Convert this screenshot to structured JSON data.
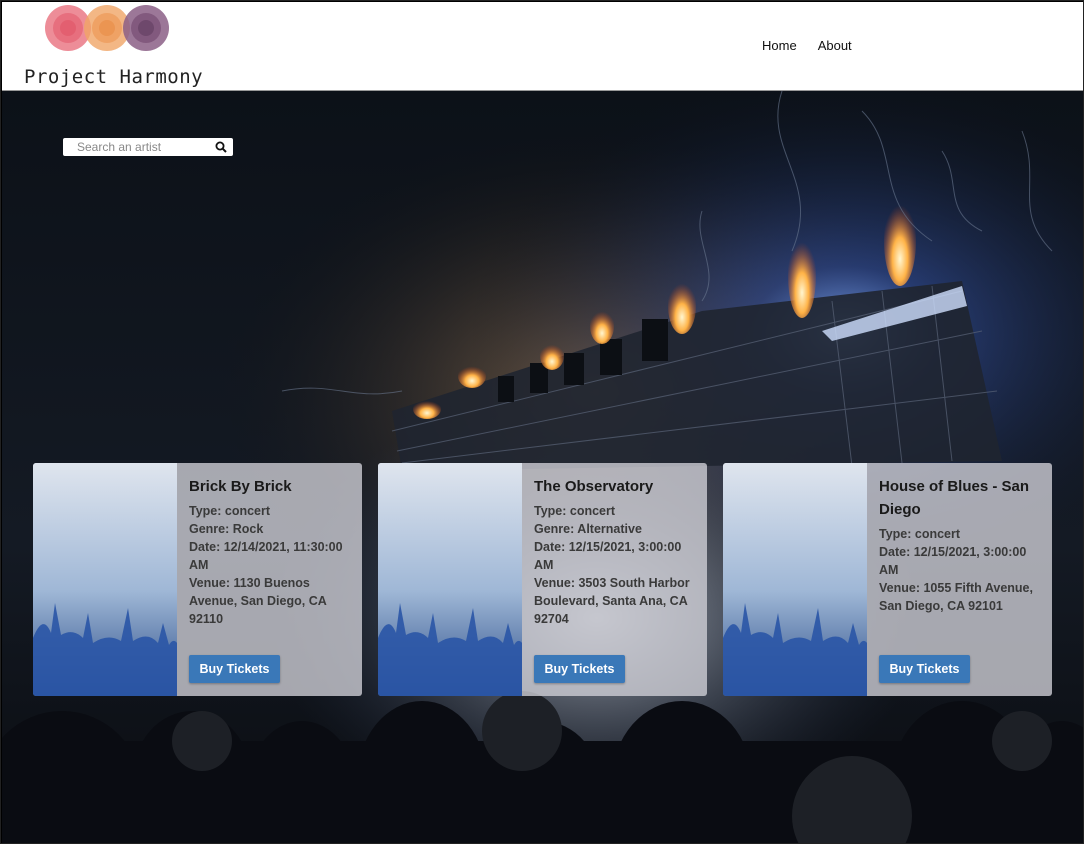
{
  "brand": {
    "name": "Project Harmony",
    "logo_colors": [
      "#e8707e",
      "#f0a566",
      "#8b5f86"
    ]
  },
  "nav": {
    "home": "Home",
    "about": "About"
  },
  "search": {
    "placeholder": "Search an artist"
  },
  "events": [
    {
      "title": "Brick By Brick",
      "type": "Type: concert",
      "genre": "Genre: Rock",
      "date": "Date: 12/14/2021, 11:30:00 AM",
      "venue": "Venue: 1130 Buenos Avenue, San Diego, CA 92110",
      "button": "Buy Tickets"
    },
    {
      "title": "The Observatory",
      "type": "Type: concert",
      "genre": "Genre: Alternative",
      "date": "Date: 12/15/2021, 3:00:00 AM",
      "venue": "Venue: 3503 South Harbor Boulevard, Santa Ana, CA 92704",
      "button": "Buy Tickets"
    },
    {
      "title": "House of Blues - San Diego",
      "type": "Type: concert",
      "genre": "",
      "date": "Date: 12/15/2021, 3:00:00 AM",
      "venue": "Venue: 1055 Fifth Avenue, San Diego, CA 92101",
      "button": "Buy Tickets"
    }
  ],
  "colors": {
    "button": "#3a78b8",
    "header_bg": "#ffffff"
  }
}
